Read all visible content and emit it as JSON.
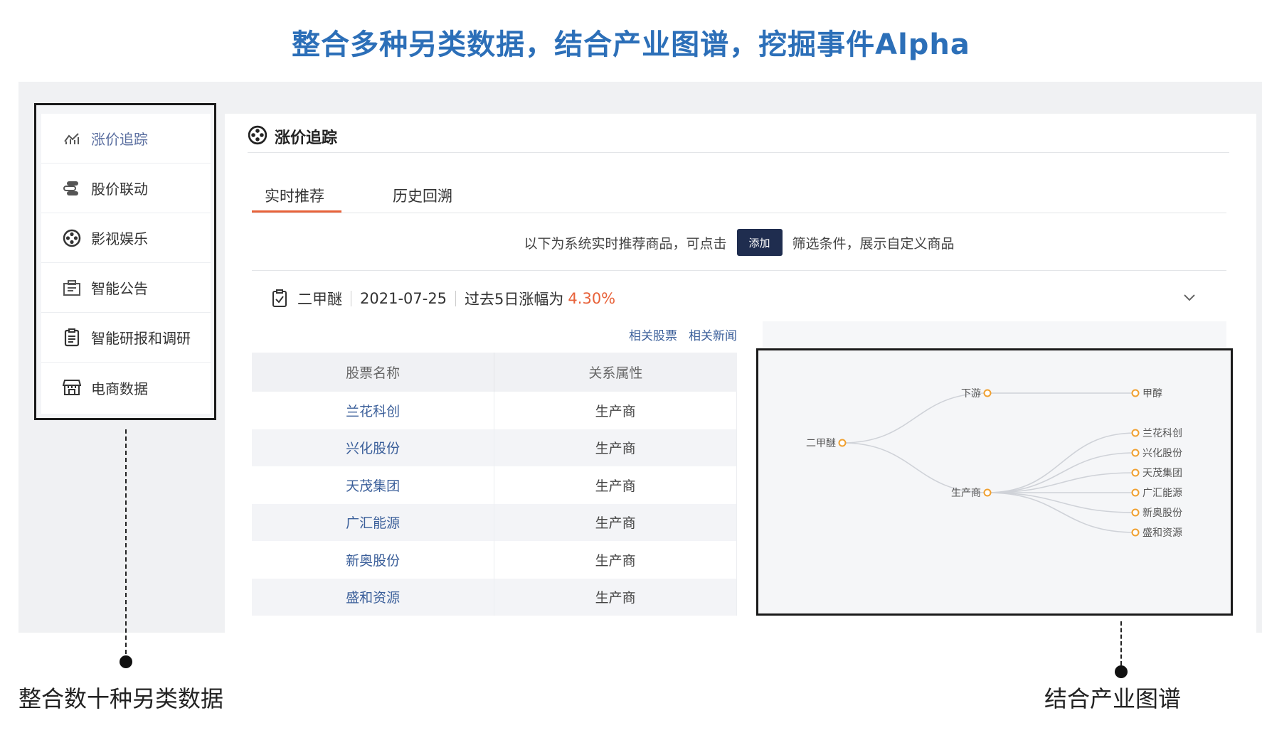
{
  "headline": "整合多种另类数据，结合产业图谱，挖掘事件Alpha",
  "sidebar": {
    "items": [
      {
        "label": "涨价追踪",
        "icon": "trend-chart-icon",
        "active": true
      },
      {
        "label": "股价联动",
        "icon": "linked-stack-icon"
      },
      {
        "label": "影视娱乐",
        "icon": "film-reel-icon"
      },
      {
        "label": "智能公告",
        "icon": "announcement-icon"
      },
      {
        "label": "智能研报和调研",
        "icon": "report-clipboard-icon"
      },
      {
        "label": "电商数据",
        "icon": "storefront-icon"
      }
    ]
  },
  "captions": {
    "left": "整合数十种另类数据",
    "right": "结合产业图谱"
  },
  "panel": {
    "title": "涨价追踪",
    "title_icon": "film-reel-icon",
    "tabs": [
      {
        "label": "实时推荐",
        "active": true
      },
      {
        "label": "历史回溯"
      }
    ],
    "hint_prefix": "以下为系统实时推荐商品，可点击",
    "add_button": "添加",
    "hint_suffix": "筛选条件，展示自定义商品",
    "event": {
      "icon": "clipboard-check-icon",
      "product": "二甲醚",
      "date": "2021-07-25",
      "change_label": "过去5日涨幅为",
      "change_value": "4.30%"
    },
    "links": [
      "相关股票",
      "相关新闻"
    ],
    "accent_color": "#e8623a"
  },
  "table": {
    "headers": [
      "股票名称",
      "关系属性"
    ],
    "rows": [
      [
        "兰花科创",
        "生产商"
      ],
      [
        "兴化股份",
        "生产商"
      ],
      [
        "天茂集团",
        "生产商"
      ],
      [
        "广汇能源",
        "生产商"
      ],
      [
        "新奥股份",
        "生产商"
      ],
      [
        "盛和资源",
        "生产商"
      ]
    ]
  },
  "graph": {
    "root": "二甲醚",
    "branches": [
      {
        "label": "下游",
        "children": [
          "甲醇"
        ]
      },
      {
        "label": "生产商",
        "children": [
          "兰花科创",
          "兴化股份",
          "天茂集团",
          "广汇能源",
          "新奥股份",
          "盛和资源"
        ]
      }
    ],
    "node_color": "#f0a030"
  }
}
